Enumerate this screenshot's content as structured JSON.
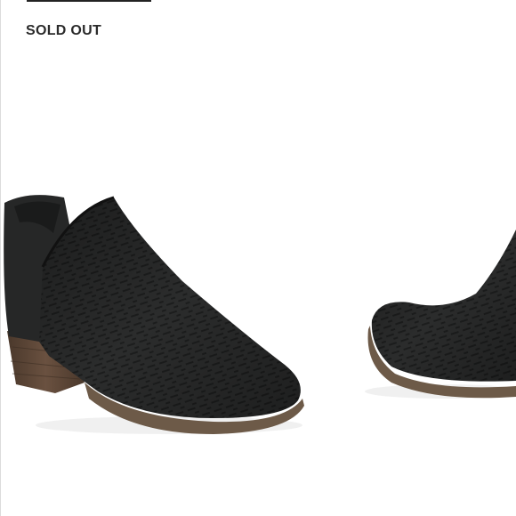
{
  "status": {
    "label": "SOLD OUT"
  },
  "product": {
    "image_icon": "ankle-bootie-photo",
    "colors": {
      "upper": "#2a2b2b",
      "upper_highlight": "#3a3b3b",
      "heel": "#5b4535",
      "sole": "#6d5a48",
      "badge_text": "#2b2b2b"
    }
  }
}
